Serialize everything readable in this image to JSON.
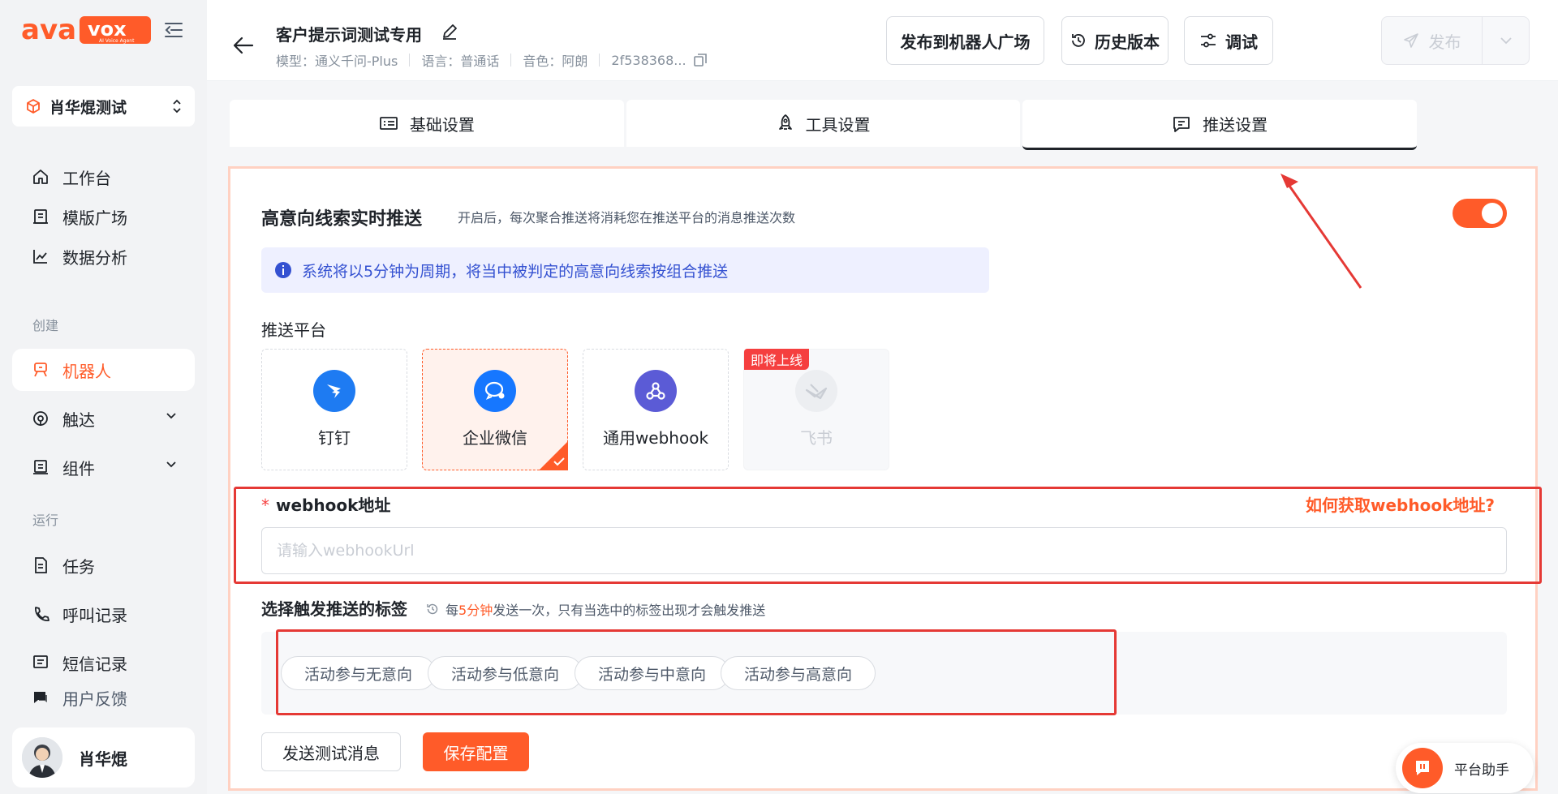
{
  "brand": {
    "logo_text": "ava vox",
    "logo_tagline": "AI Voice Agent",
    "accent": "#ff5b29"
  },
  "sidebar": {
    "workspace": "肖华焜测试",
    "items_top": [
      {
        "label": "工作台",
        "icon": "home-icon"
      },
      {
        "label": "模版广场",
        "icon": "template-icon"
      },
      {
        "label": "数据分析",
        "icon": "chart-icon"
      }
    ],
    "section_create": "创建",
    "items_create": [
      {
        "label": "机器人",
        "icon": "robot-icon",
        "active": true
      },
      {
        "label": "触达",
        "icon": "reach-icon"
      },
      {
        "label": "组件",
        "icon": "component-icon"
      }
    ],
    "section_run": "运行",
    "items_run": [
      {
        "label": "任务",
        "icon": "task-icon"
      },
      {
        "label": "呼叫记录",
        "icon": "phone-icon"
      },
      {
        "label": "短信记录",
        "icon": "sms-icon"
      },
      {
        "label": "用户反馈",
        "icon": "feedback-icon"
      }
    ],
    "user_name": "肖华焜"
  },
  "header": {
    "title": "客户提示词测试专用",
    "meta": {
      "model": "模型：通义千问-Plus",
      "language": "语言：普通话",
      "voice": "音色：阿朗",
      "id": "2f538368..."
    },
    "buttons": {
      "publish_square": "发布到机器人广场",
      "history": "历史版本",
      "debug": "调试",
      "publish": "发布"
    }
  },
  "tabs": [
    {
      "label": "基础设置",
      "active": false
    },
    {
      "label": "工具设置",
      "active": false
    },
    {
      "label": "推送设置",
      "active": true
    }
  ],
  "push": {
    "title": "高意向线索实时推送",
    "hint": "开启后，每次聚合推送将消耗您在推送平台的消息推送次数",
    "enabled": true,
    "info": "系统将以5分钟为周期，将当中被判定的高意向线索按组合推送",
    "platform_label": "推送平台",
    "platforms": [
      {
        "name": "钉钉",
        "state": "normal"
      },
      {
        "name": "企业微信",
        "state": "selected"
      },
      {
        "name": "通用webhook",
        "state": "normal"
      },
      {
        "name": "飞书",
        "state": "disabled",
        "badge": "即将上线"
      }
    ],
    "webhook_label": "webhook地址",
    "webhook_required": "*",
    "webhook_help": "如何获取webhook地址?",
    "webhook_placeholder": "请输入webhookUrl",
    "webhook_value": "",
    "tag_label": "选择触发推送的标签",
    "tag_hint_prefix": "每",
    "tag_hint_highlight": "5分钟",
    "tag_hint_suffix": "发送一次，只有当选中的标签出现才会触发推送",
    "tags": [
      "活动参与无意向",
      "活动参与低意向",
      "活动参与中意向",
      "活动参与高意向"
    ],
    "btn_test": "发送测试消息",
    "btn_save": "保存配置"
  },
  "assistant": {
    "label": "平台助手"
  }
}
